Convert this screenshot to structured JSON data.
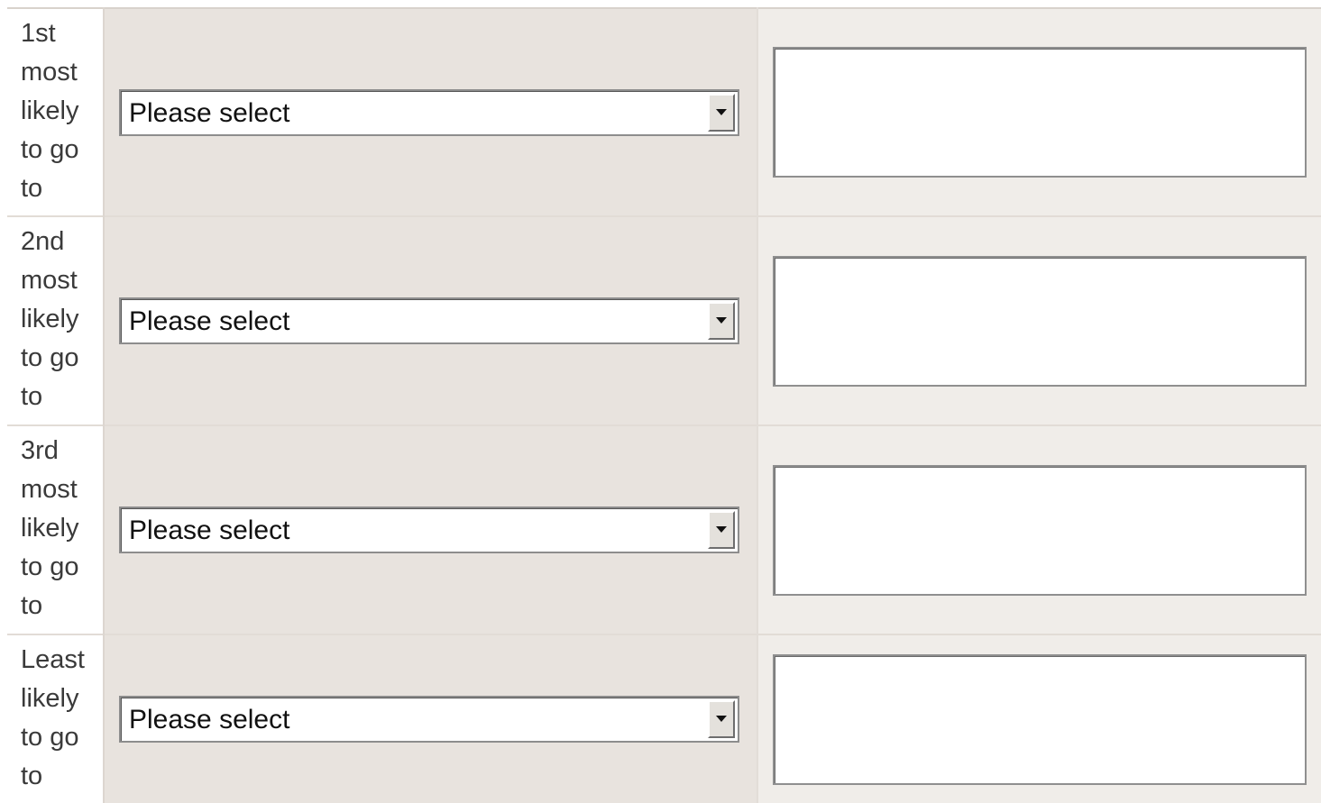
{
  "rows": [
    {
      "label": "1st most likely to go to",
      "select_value": "Please select",
      "text_value": ""
    },
    {
      "label": "2nd most likely to go to",
      "select_value": "Please select",
      "text_value": ""
    },
    {
      "label": "3rd most likely to go to",
      "select_value": "Please select",
      "text_value": ""
    },
    {
      "label": "Least likely to go to",
      "select_value": "Please select",
      "text_value": ""
    }
  ],
  "icons": {
    "dropdown": "chevron-down-icon"
  },
  "colors": {
    "select_column_bg": "#e8e3de",
    "text_column_bg": "#f0ede9",
    "label_text": "#3a3a3a"
  }
}
